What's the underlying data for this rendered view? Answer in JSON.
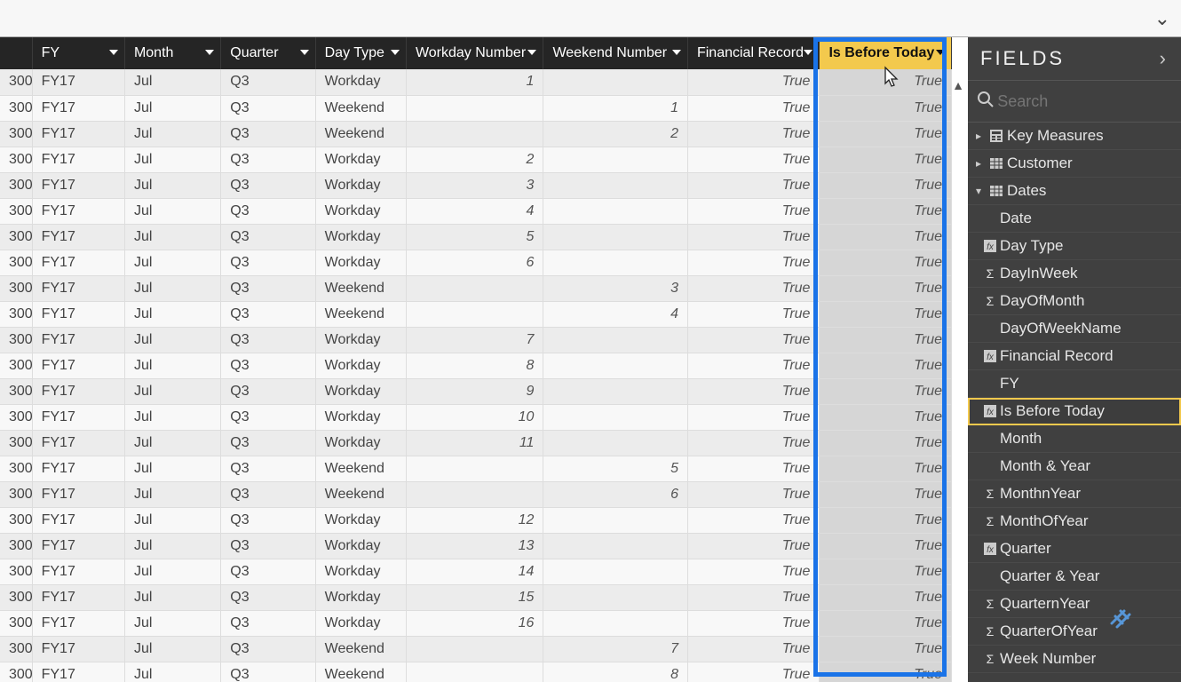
{
  "fields_panel": {
    "title": "FIELDS",
    "search_placeholder": "Search",
    "tables": [
      {
        "name": "Key Measures",
        "expanded": false,
        "icon": "calc"
      },
      {
        "name": "Customer",
        "expanded": false,
        "icon": "table"
      },
      {
        "name": "Dates",
        "expanded": true,
        "icon": "table",
        "fields": [
          {
            "name": "Date",
            "icon": ""
          },
          {
            "name": "Day Type",
            "icon": "fx"
          },
          {
            "name": "DayInWeek",
            "icon": "sigma"
          },
          {
            "name": "DayOfMonth",
            "icon": "sigma"
          },
          {
            "name": "DayOfWeekName",
            "icon": ""
          },
          {
            "name": "Financial Record",
            "icon": "fx"
          },
          {
            "name": "FY",
            "icon": ""
          },
          {
            "name": "Is Before Today",
            "icon": "fx",
            "selected": true
          },
          {
            "name": "Month",
            "icon": ""
          },
          {
            "name": "Month & Year",
            "icon": ""
          },
          {
            "name": "MonthnYear",
            "icon": "sigma"
          },
          {
            "name": "MonthOfYear",
            "icon": "sigma"
          },
          {
            "name": "Quarter",
            "icon": "fx"
          },
          {
            "name": "Quarter & Year",
            "icon": ""
          },
          {
            "name": "QuarternYear",
            "icon": "sigma"
          },
          {
            "name": "QuarterOfYear",
            "icon": "sigma"
          },
          {
            "name": "Week Number",
            "icon": "sigma"
          }
        ]
      }
    ]
  },
  "grid": {
    "columns": [
      {
        "key": "trunc",
        "label": "",
        "cls": "col-trunc"
      },
      {
        "key": "fy",
        "label": "FY",
        "cls": "col-fy"
      },
      {
        "key": "month",
        "label": "Month",
        "cls": "col-month"
      },
      {
        "key": "quarter",
        "label": "Quarter",
        "cls": "col-quarter"
      },
      {
        "key": "daytype",
        "label": "Day Type",
        "cls": "col-daytype"
      },
      {
        "key": "workday",
        "label": "Workday Number",
        "cls": "col-workday",
        "align": "r"
      },
      {
        "key": "weekend",
        "label": "Weekend Number",
        "cls": "col-weekend",
        "align": "r"
      },
      {
        "key": "fin",
        "label": "Financial Record",
        "cls": "col-fin",
        "align": "r2"
      },
      {
        "key": "before",
        "label": "Is Before Today",
        "cls": "col-before",
        "align": "r2",
        "selected": true
      }
    ],
    "rows": [
      {
        "trunc": "300",
        "fy": "FY17",
        "month": "Jul",
        "quarter": "Q3",
        "daytype": "Workday",
        "workday": "1",
        "weekend": "",
        "fin": "True",
        "before": "True"
      },
      {
        "trunc": "300",
        "fy": "FY17",
        "month": "Jul",
        "quarter": "Q3",
        "daytype": "Weekend",
        "workday": "",
        "weekend": "1",
        "fin": "True",
        "before": "True"
      },
      {
        "trunc": "300",
        "fy": "FY17",
        "month": "Jul",
        "quarter": "Q3",
        "daytype": "Weekend",
        "workday": "",
        "weekend": "2",
        "fin": "True",
        "before": "True"
      },
      {
        "trunc": "300",
        "fy": "FY17",
        "month": "Jul",
        "quarter": "Q3",
        "daytype": "Workday",
        "workday": "2",
        "weekend": "",
        "fin": "True",
        "before": "True"
      },
      {
        "trunc": "300",
        "fy": "FY17",
        "month": "Jul",
        "quarter": "Q3",
        "daytype": "Workday",
        "workday": "3",
        "weekend": "",
        "fin": "True",
        "before": "True"
      },
      {
        "trunc": "300",
        "fy": "FY17",
        "month": "Jul",
        "quarter": "Q3",
        "daytype": "Workday",
        "workday": "4",
        "weekend": "",
        "fin": "True",
        "before": "True"
      },
      {
        "trunc": "300",
        "fy": "FY17",
        "month": "Jul",
        "quarter": "Q3",
        "daytype": "Workday",
        "workday": "5",
        "weekend": "",
        "fin": "True",
        "before": "True"
      },
      {
        "trunc": "300",
        "fy": "FY17",
        "month": "Jul",
        "quarter": "Q3",
        "daytype": "Workday",
        "workday": "6",
        "weekend": "",
        "fin": "True",
        "before": "True"
      },
      {
        "trunc": "300",
        "fy": "FY17",
        "month": "Jul",
        "quarter": "Q3",
        "daytype": "Weekend",
        "workday": "",
        "weekend": "3",
        "fin": "True",
        "before": "True"
      },
      {
        "trunc": "300",
        "fy": "FY17",
        "month": "Jul",
        "quarter": "Q3",
        "daytype": "Weekend",
        "workday": "",
        "weekend": "4",
        "fin": "True",
        "before": "True"
      },
      {
        "trunc": "300",
        "fy": "FY17",
        "month": "Jul",
        "quarter": "Q3",
        "daytype": "Workday",
        "workday": "7",
        "weekend": "",
        "fin": "True",
        "before": "True"
      },
      {
        "trunc": "300",
        "fy": "FY17",
        "month": "Jul",
        "quarter": "Q3",
        "daytype": "Workday",
        "workday": "8",
        "weekend": "",
        "fin": "True",
        "before": "True"
      },
      {
        "trunc": "300",
        "fy": "FY17",
        "month": "Jul",
        "quarter": "Q3",
        "daytype": "Workday",
        "workday": "9",
        "weekend": "",
        "fin": "True",
        "before": "True"
      },
      {
        "trunc": "300",
        "fy": "FY17",
        "month": "Jul",
        "quarter": "Q3",
        "daytype": "Workday",
        "workday": "10",
        "weekend": "",
        "fin": "True",
        "before": "True"
      },
      {
        "trunc": "300",
        "fy": "FY17",
        "month": "Jul",
        "quarter": "Q3",
        "daytype": "Workday",
        "workday": "11",
        "weekend": "",
        "fin": "True",
        "before": "True"
      },
      {
        "trunc": "300",
        "fy": "FY17",
        "month": "Jul",
        "quarter": "Q3",
        "daytype": "Weekend",
        "workday": "",
        "weekend": "5",
        "fin": "True",
        "before": "True"
      },
      {
        "trunc": "300",
        "fy": "FY17",
        "month": "Jul",
        "quarter": "Q3",
        "daytype": "Weekend",
        "workday": "",
        "weekend": "6",
        "fin": "True",
        "before": "True"
      },
      {
        "trunc": "300",
        "fy": "FY17",
        "month": "Jul",
        "quarter": "Q3",
        "daytype": "Workday",
        "workday": "12",
        "weekend": "",
        "fin": "True",
        "before": "True"
      },
      {
        "trunc": "300",
        "fy": "FY17",
        "month": "Jul",
        "quarter": "Q3",
        "daytype": "Workday",
        "workday": "13",
        "weekend": "",
        "fin": "True",
        "before": "True"
      },
      {
        "trunc": "300",
        "fy": "FY17",
        "month": "Jul",
        "quarter": "Q3",
        "daytype": "Workday",
        "workday": "14",
        "weekend": "",
        "fin": "True",
        "before": "True"
      },
      {
        "trunc": "300",
        "fy": "FY17",
        "month": "Jul",
        "quarter": "Q3",
        "daytype": "Workday",
        "workday": "15",
        "weekend": "",
        "fin": "True",
        "before": "True"
      },
      {
        "trunc": "300",
        "fy": "FY17",
        "month": "Jul",
        "quarter": "Q3",
        "daytype": "Workday",
        "workday": "16",
        "weekend": "",
        "fin": "True",
        "before": "True"
      },
      {
        "trunc": "300",
        "fy": "FY17",
        "month": "Jul",
        "quarter": "Q3",
        "daytype": "Weekend",
        "workday": "",
        "weekend": "7",
        "fin": "True",
        "before": "True"
      },
      {
        "trunc": "300",
        "fy": "FY17",
        "month": "Jul",
        "quarter": "Q3",
        "daytype": "Weekend",
        "workday": "",
        "weekend": "8",
        "fin": "True",
        "before": "True"
      }
    ]
  }
}
